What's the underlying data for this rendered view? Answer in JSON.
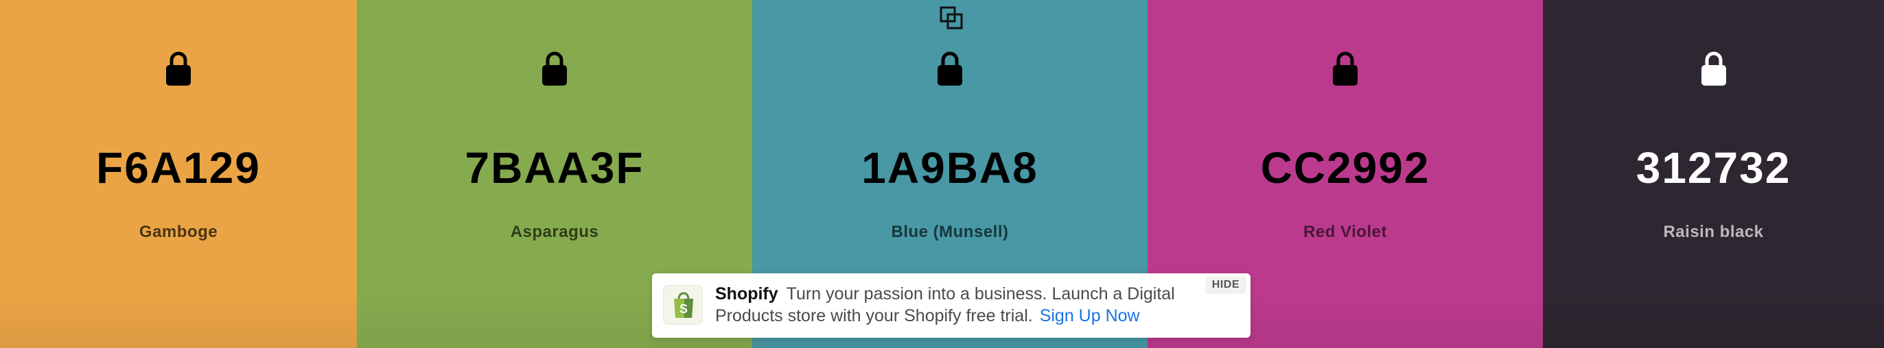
{
  "palette": {
    "colors": [
      {
        "hex": "F6A129",
        "name": "Gamboge",
        "bg": "#EBA445",
        "fg": "#000000",
        "name_color": "#4a3512"
      },
      {
        "hex": "7BAA3F",
        "name": "Asparagus",
        "bg": "#86AB4F",
        "fg": "#000000",
        "name_color": "#2f3d19"
      },
      {
        "hex": "1A9BA8",
        "name": "Blue (Munsell)",
        "bg": "#4898A5",
        "fg": "#000000",
        "name_color": "#17373c"
      },
      {
        "hex": "CC2992",
        "name": "Red Violet",
        "bg": "#BC3A8E",
        "fg": "#000000",
        "name_color": "#4a1636"
      },
      {
        "hex": "312732",
        "name": "Raisin black",
        "bg": "#2E2731",
        "fg": "#ffffff",
        "name_color": "#bdb8c0"
      }
    ],
    "copy_icon": "copy-icon",
    "lock_icon": "lock-icon"
  },
  "ad": {
    "brand": "Shopify",
    "text": "Turn your passion into a business. Launch a Digital Products store with your Shopify free trial.",
    "cta": "Sign Up Now",
    "hide_label": "HIDE",
    "logo_icon": "shopify-bag-icon",
    "cta_color": "#1a73e8"
  }
}
